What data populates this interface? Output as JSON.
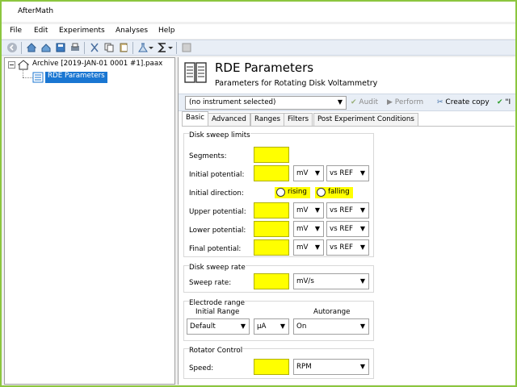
{
  "app": {
    "title": "AfterMath"
  },
  "menu": [
    "File",
    "Edit",
    "Experiments",
    "Analyses",
    "Help"
  ],
  "tree": {
    "archive": "Archive [2019-JAN-01 0001 #1].paax",
    "selected": "RDE Parameters"
  },
  "header": {
    "title": "RDE Parameters",
    "subtitle": "Parameters for Rotating Disk Voltammetry"
  },
  "instrument": {
    "selected": "(no instrument selected)"
  },
  "actions": {
    "audit": "Audit",
    "perform": "Perform",
    "create_copy": "Create copy",
    "truncated": "\"I"
  },
  "tabs": [
    "Basic",
    "Advanced",
    "Ranges",
    "Filters",
    "Post Experiment Conditions"
  ],
  "sweep_limits": {
    "title": "Disk sweep limits",
    "segments": "Segments:",
    "initial_potential": "Initial potential:",
    "initial_direction": "Initial direction:",
    "rising": "rising",
    "falling": "falling",
    "upper_potential": "Upper potential:",
    "lower_potential": "Lower potential:",
    "final_potential": "Final potential:",
    "unit": "mV",
    "ref": "vs REF"
  },
  "sweep_rate": {
    "title": "Disk sweep rate",
    "label": "Sweep rate:",
    "unit": "mV/s"
  },
  "electrode_range": {
    "title": "Electrode range",
    "initial_range_label": "Initial Range",
    "autorange_label": "Autorange",
    "initial_range": "Default",
    "unit": "µA",
    "autorange": "On"
  },
  "rotator": {
    "title": "Rotator Control",
    "label": "Speed:",
    "unit": "RPM"
  }
}
